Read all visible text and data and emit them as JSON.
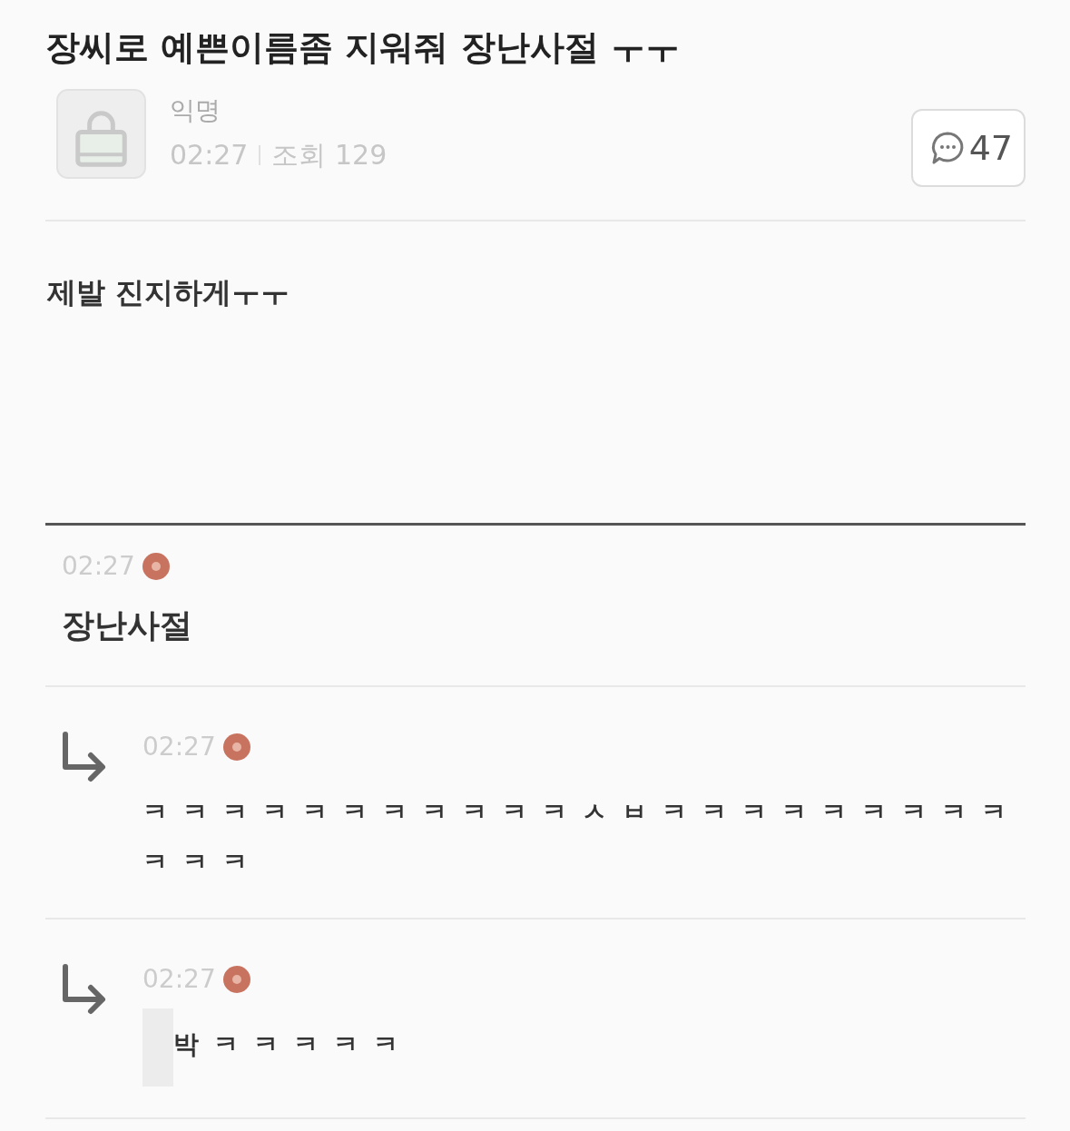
{
  "post": {
    "title": "장씨로 예쁜이름좀 지워줘 장난사절 ㅜㅜ",
    "author": "익명",
    "time": "02:27",
    "views": "조회 129",
    "comment_count": "47",
    "body": "제발 진지하게ㅜㅜ"
  },
  "comments": [
    {
      "kind": "comment",
      "time": "02:27",
      "new": true,
      "text": "장난사절"
    },
    {
      "kind": "reply",
      "time": "02:27",
      "new": true,
      "text": "ㅋㅋㅋㅋㅋㅋㅋㅋㅋㅋㅋㅅㅂㅋㅋㅋㅋㅋㅋㅋㅋㅋㅋㅋㅋ"
    },
    {
      "kind": "reply",
      "time": "02:27",
      "new": true,
      "redacted": true,
      "text": "박ㅋㅋㅋㅋㅋ"
    }
  ]
}
